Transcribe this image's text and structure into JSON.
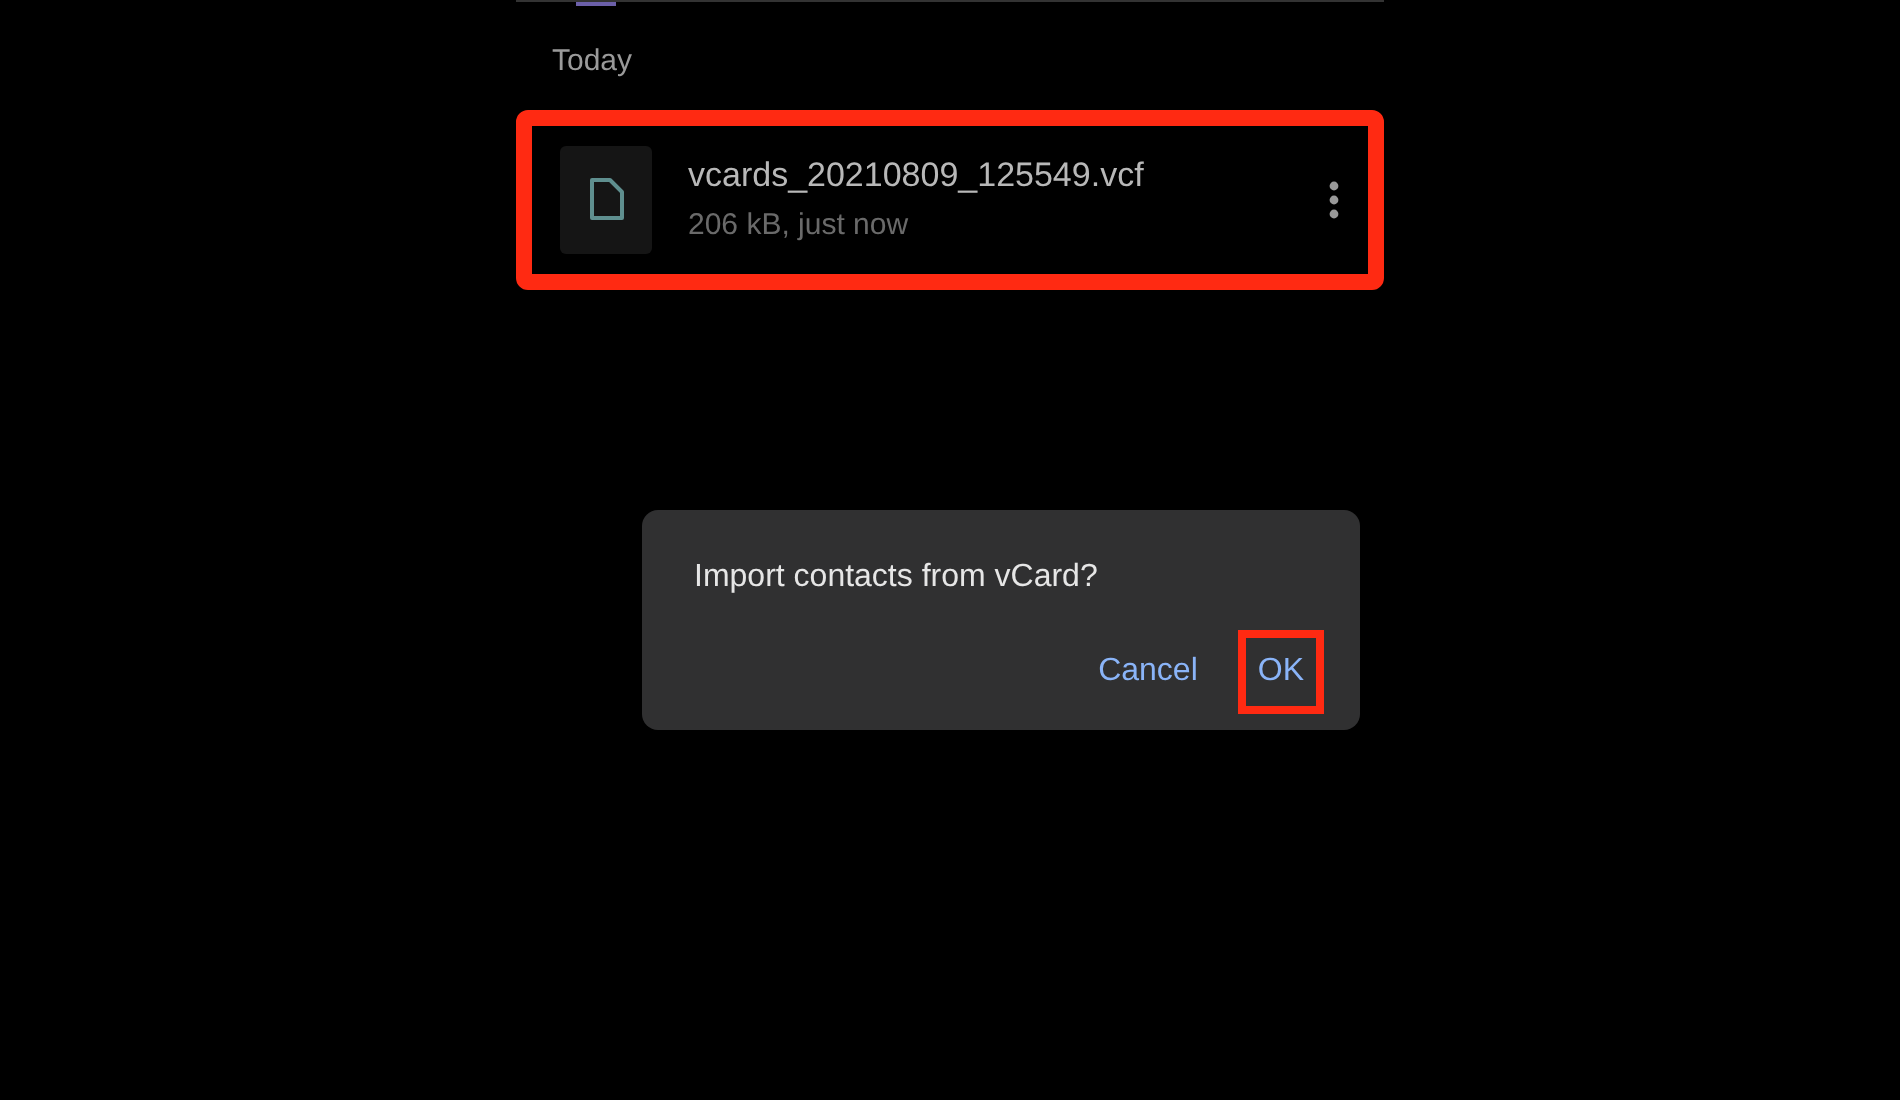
{
  "section_header": "Today",
  "files": [
    {
      "name": "vcards_20210809_125549.vcf",
      "details": "206 kB, just now",
      "highlighted": true
    }
  ],
  "dialog": {
    "message": "Import contacts from vCard?",
    "buttons": [
      {
        "label": "Cancel",
        "highlighted": false
      },
      {
        "label": "OK",
        "highlighted": true
      }
    ]
  }
}
